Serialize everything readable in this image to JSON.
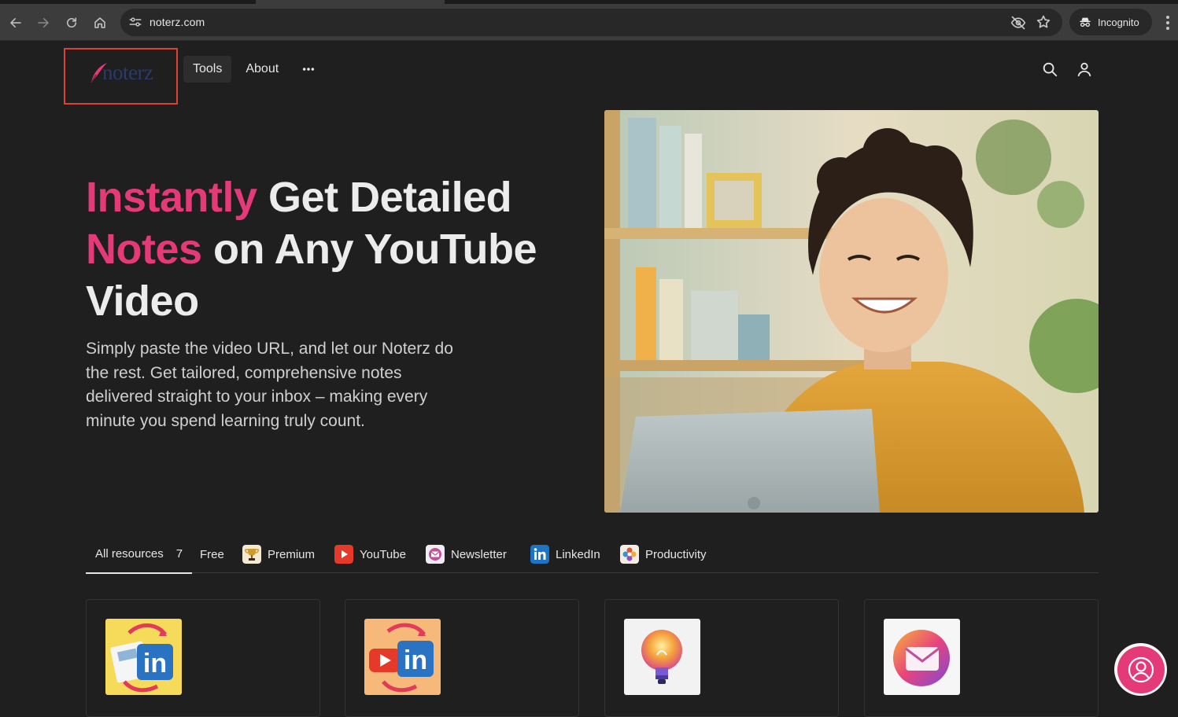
{
  "browser": {
    "url": "noterz.com",
    "profile_label": "Incognito"
  },
  "header": {
    "logo_text": "noterz",
    "nav": [
      {
        "label": "Tools"
      },
      {
        "label": "About"
      }
    ],
    "more_label": "•••"
  },
  "hero": {
    "title_accent_1": "Instantly",
    "title_rest_1": " Get Detailed",
    "title_accent_2": "Notes",
    "title_rest_2": " on Any YouTube Video",
    "subtitle": "Simply paste the video URL, and let our Noterz do the rest. Get tailored, comprehensive notes delivered straight to your inbox – making every minute you spend learning truly count."
  },
  "tabs": [
    {
      "label": "All resources",
      "count": "7",
      "active": true,
      "icon": null
    },
    {
      "label": "Free",
      "icon": null
    },
    {
      "label": "Premium",
      "icon": "trophy-icon"
    },
    {
      "label": "YouTube",
      "icon": "youtube-icon"
    },
    {
      "label": "Newsletter",
      "icon": "newsletter-icon"
    },
    {
      "label": "LinkedIn",
      "icon": "linkedin-icon"
    },
    {
      "label": "Productivity",
      "icon": "productivity-icon"
    }
  ],
  "cards": [
    {
      "icon": "article-to-linkedin-icon"
    },
    {
      "icon": "youtube-to-linkedin-icon"
    },
    {
      "icon": "lightbulb-icon"
    },
    {
      "icon": "email-icon"
    }
  ],
  "colors": {
    "accent": "#e43a78",
    "background": "#1f1f1f",
    "highlight_box": "#e0402f"
  }
}
